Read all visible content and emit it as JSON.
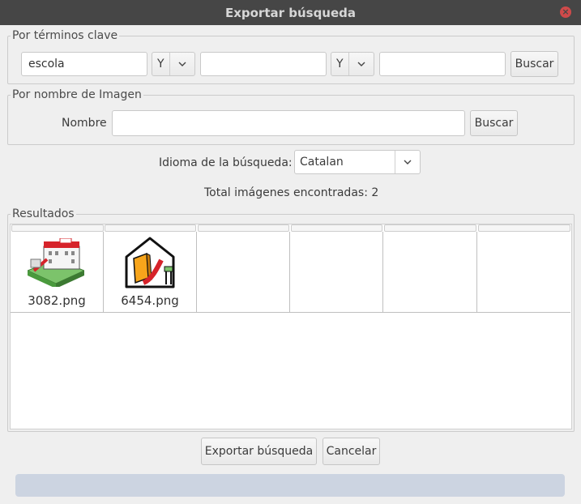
{
  "window": {
    "title": "Exportar búsqueda"
  },
  "keywords": {
    "legend": "Por términos clave",
    "field1": "escola",
    "op1": "Y",
    "field2": "",
    "op2": "Y",
    "field3": "",
    "search_label": "Buscar"
  },
  "by_name": {
    "legend": "Por nombre de Imagen",
    "label": "Nombre",
    "value": "",
    "search_label": "Buscar"
  },
  "language": {
    "label": "Idioma de la búsqueda:",
    "selected": "Catalan"
  },
  "total_text": "Total imágenes encontradas: 2",
  "results": {
    "legend": "Resultados",
    "items": [
      {
        "name": "3082.png",
        "icon": "school-building-icon"
      },
      {
        "name": "6454.png",
        "icon": "school-book-slide-icon"
      }
    ]
  },
  "footer": {
    "export_label": "Exportar búsqueda",
    "cancel_label": "Cancelar"
  },
  "colors": {
    "titlebar": "#464646",
    "close": "#cf4a4a",
    "progress": "#ccd4e1"
  }
}
